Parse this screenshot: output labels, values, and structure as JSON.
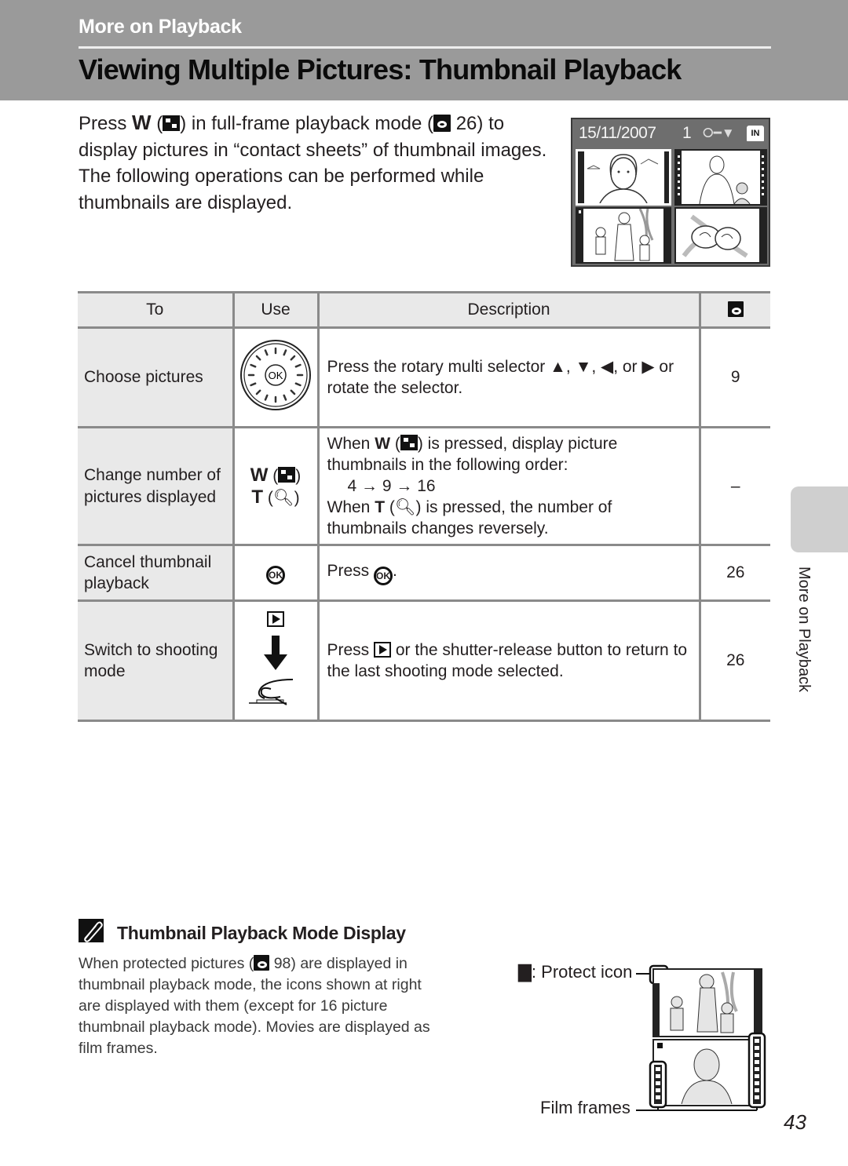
{
  "header": {
    "section": "More on Playback",
    "title": "Viewing Multiple Pictures: Thumbnail Playback"
  },
  "intro": {
    "press": "Press",
    "w_key": "W",
    "mid1": ") in full-frame playback mode (",
    "ref_page": "26",
    "mid2": ") to display pictures in “contact sheets” of thumbnail images. The following operations can be performed while thumbnails are displayed."
  },
  "lcd": {
    "date": "15/11/2007",
    "frame_number": "1",
    "icons": [
      "key-icon",
      "protect-icon",
      "internal-memory-icon"
    ],
    "memory_label": "IN"
  },
  "table": {
    "headers": [
      "To",
      "Use",
      "Description",
      "ref-icon"
    ],
    "rows": [
      {
        "to": "Choose pictures",
        "use": "rotary-multi-selector",
        "use_label": "OK",
        "desc_a": "Press the rotary multi selector",
        "desc_b": "or",
        "desc_c": "or rotate the selector.",
        "ref": "9"
      },
      {
        "to": "Change number of pictures displayed",
        "use_w": "W",
        "use_t": "T",
        "desc_line1a": "When",
        "desc_line1b": ") is pressed, display picture thumbnails in the following order:",
        "desc_order": "4 → 9 → 16",
        "desc_line2a": "When",
        "desc_line2b": ") is pressed, the number of thumbnails changes reversely.",
        "ref": "–"
      },
      {
        "to": "Cancel thumbnail playback",
        "use_label": "OK",
        "desc_a": "Press",
        "desc_b": ".",
        "ref": "26"
      },
      {
        "to": "Switch to shooting mode",
        "desc_a": "Press",
        "desc_b": "or the shutter-release button to return to the last shooting mode selected.",
        "ref": "26"
      }
    ]
  },
  "side_tab": {
    "label": "More on Playback"
  },
  "note": {
    "title": "Thumbnail Playback Mode Display",
    "body_a": "When protected pictures (",
    "ref_page": "98",
    "body_b": ") are displayed in thumbnail playback mode, the icons shown at right are displayed with them (except for 16 picture thumbnail playback mode). Movies are displayed as film frames.",
    "protect_label": ": Protect icon",
    "film_label": "Film frames"
  },
  "page_number": "43"
}
